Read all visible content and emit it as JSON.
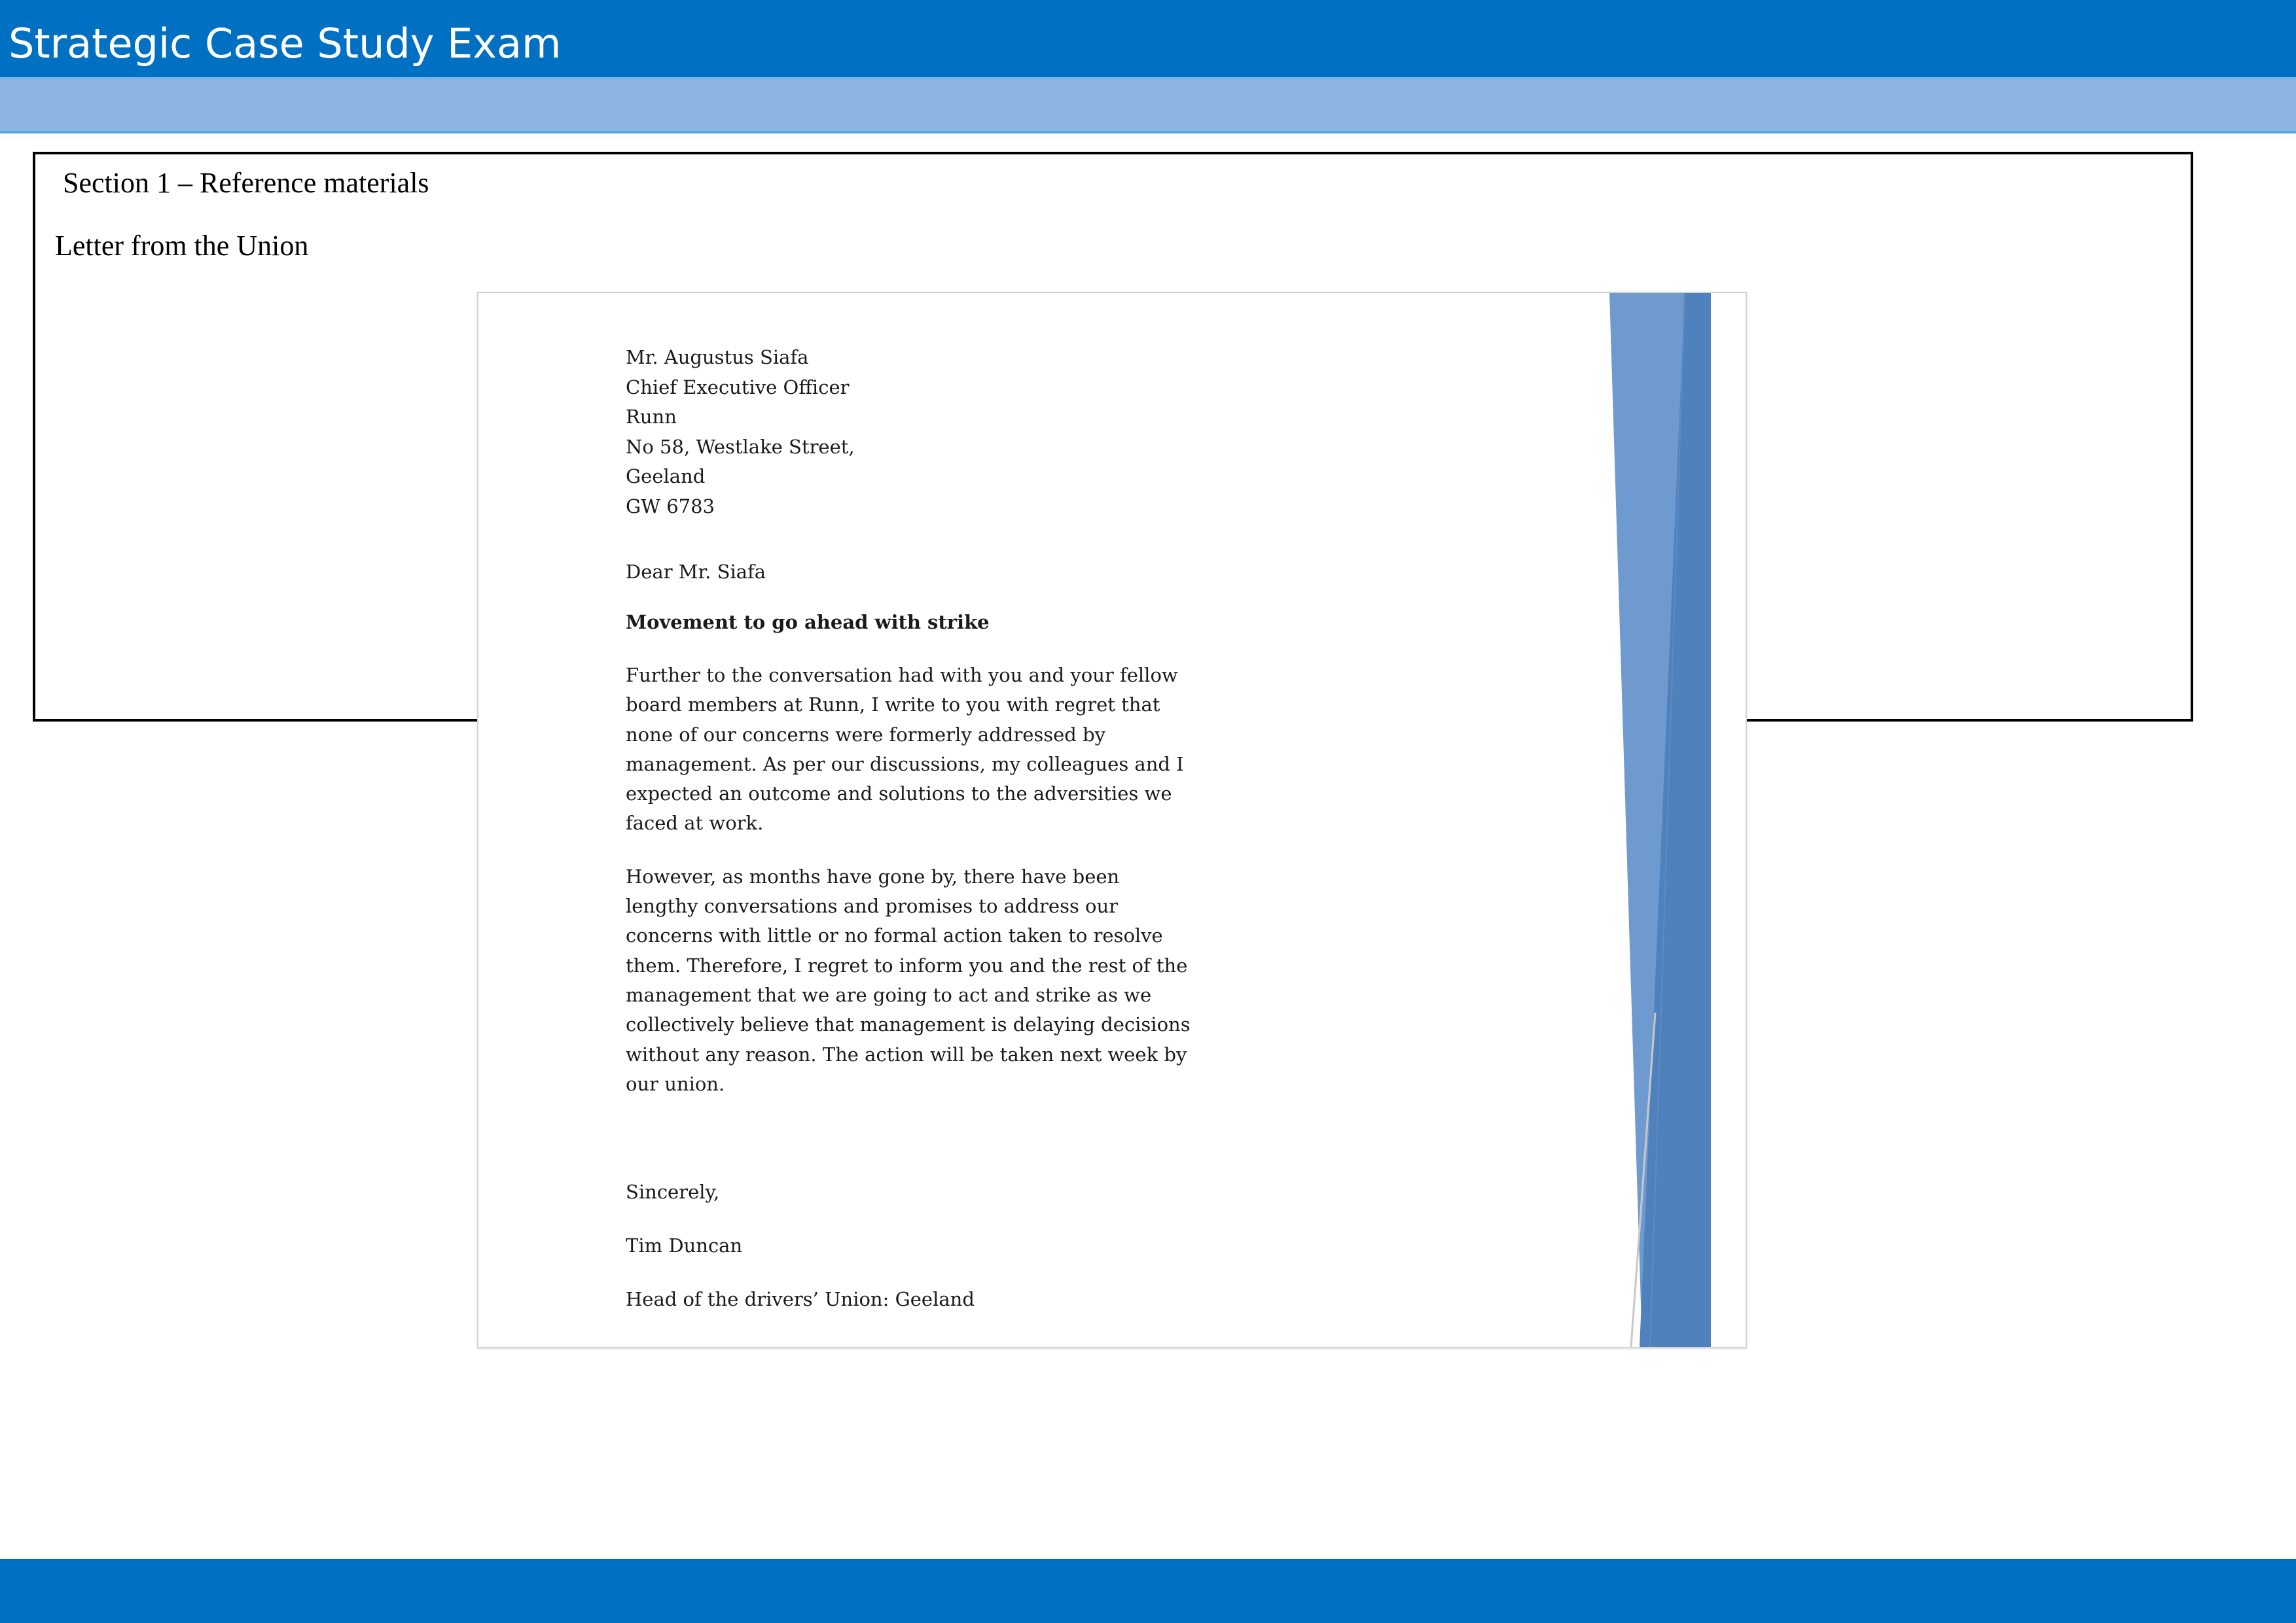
{
  "header": {
    "title": "Strategic Case Study Exam"
  },
  "section": {
    "heading": "Section 1 – Reference materials",
    "subheading": "Letter from the Union"
  },
  "letter": {
    "recipient": [
      "Mr. Augustus Siafa",
      "Chief Executive Officer",
      "Runn",
      "No 58, Westlake Street,",
      "Geeland",
      "GW 6783"
    ],
    "salutation": "Dear Mr. Siafa",
    "subject": "Movement to go ahead with strike",
    "paragraphs": [
      "Further to the conversation had with you and your fellow\nboard members at Runn, I write to you with regret that\nnone of our concerns were formerly addressed by\nmanagement. As per our discussions, my colleagues and I\nexpected an outcome and solutions to the adversities we\nfaced at work.",
      "However, as months have gone by, there have been\nlengthy conversations and promises to address our\nconcerns with little or no formal action taken to resolve\nthem. Therefore, I regret to inform you and the rest of the\nmanagement that we are going to act and strike as we\ncollectively believe that management is delaying decisions\nwithout any reason. The action will be taken next week by\nour union."
    ],
    "closing": "Sincerely,",
    "signer_name": "Tim Duncan",
    "signer_title": "Head of the drivers’ Union: Geeland"
  },
  "colors": {
    "header_blue": "#0070C3",
    "subbar_blue": "#8EB4E3",
    "deco_light_blue": "#6F9ACF",
    "deco_dark_blue": "#4F81BD"
  }
}
